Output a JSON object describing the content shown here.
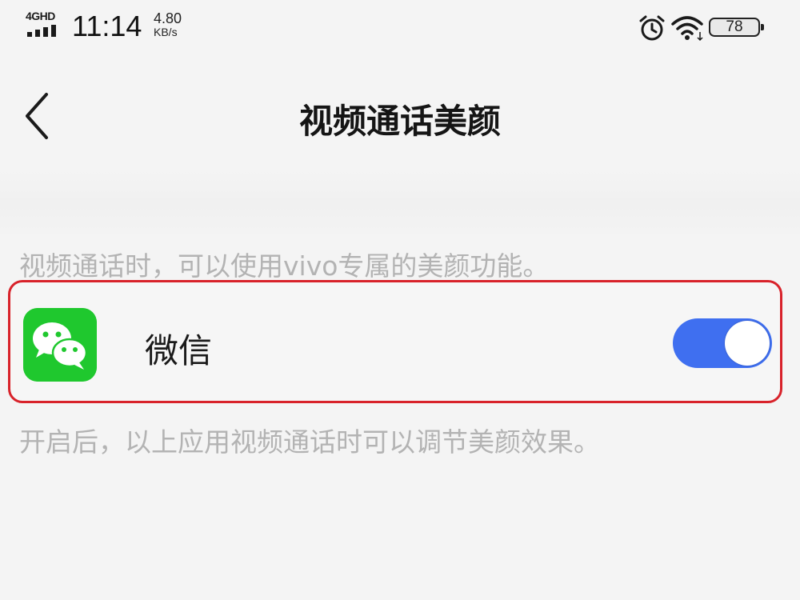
{
  "status_bar": {
    "network_type": "4GHD",
    "time": "11:14",
    "speed_value": "4.80",
    "speed_unit": "KB/s",
    "battery_level": "78",
    "icons": [
      "signal-icon",
      "alarm-icon",
      "wifi-icon",
      "battery-icon"
    ]
  },
  "header": {
    "back_icon": "chevron-left-icon",
    "title": "视频通话美颜"
  },
  "intro": {
    "text": "视频通话时，可以使用vivo专属的美颜功能。"
  },
  "app_row": {
    "icon": "wechat-icon",
    "label": "微信",
    "toggle_on": true,
    "toggle_color": "#3f6ff0",
    "highlight_color": "#d8222a"
  },
  "footer": {
    "text": "开启后，以上应用视频通话时可以调节美颜效果。"
  }
}
